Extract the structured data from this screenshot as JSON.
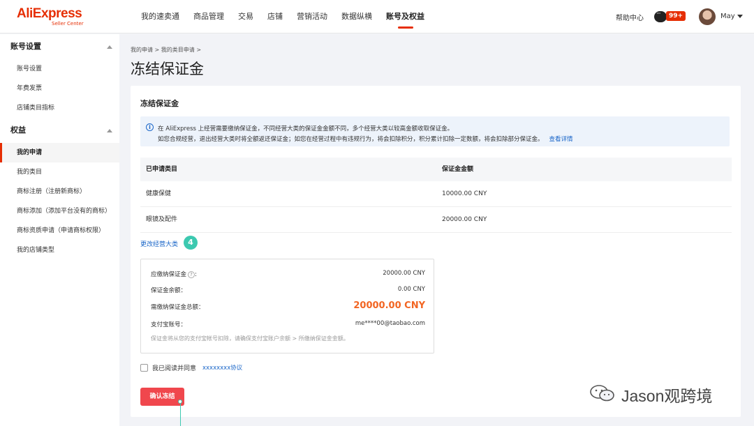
{
  "brand": {
    "name": "AliExpress",
    "sub": "Seller Center",
    "color": "#e62e04"
  },
  "nav": {
    "items": [
      {
        "label": "我的速卖通"
      },
      {
        "label": "商品管理"
      },
      {
        "label": "交易"
      },
      {
        "label": "店铺"
      },
      {
        "label": "营销活动"
      },
      {
        "label": "数据纵横"
      },
      {
        "label": "账号及权益",
        "active": true
      }
    ],
    "help": "帮助中心",
    "message_count": "99+",
    "user": "May"
  },
  "sidebar": {
    "groups": [
      {
        "title": "账号设置",
        "items": [
          "账号设置",
          "年费发票",
          "店铺类目指标"
        ]
      },
      {
        "title": "权益",
        "items": [
          "我的申请",
          "我的类目",
          "商标注册（注册新商标）",
          "商标添加（添加平台没有的商标）",
          "商标资质申请（申请商标权限）",
          "我的店铺类型"
        ]
      }
    ],
    "active": "我的申请"
  },
  "breadcrumb": "我的申请 > 我的类目申请 >",
  "page": {
    "title": "冻结保证金",
    "card_title": "冻结保证金",
    "notice": {
      "line1": "在 AliExpress 上经营需要缴纳保证金，不同经营大类的保证金金额不同，多个经营大类以较高金额收取保证金。",
      "line2": "如您合规经营，退出经营大类时将全额返还保证金；如您在经营过程中有违规行为，将会扣除积分，积分累计扣除一定数额，将会扣除部分保证金。",
      "link": "查看详情"
    },
    "table": {
      "headers": [
        "已申请类目",
        "保证金金额"
      ],
      "rows": [
        {
          "category": "健康保健",
          "amount": "10000.00  CNY"
        },
        {
          "category": "眼镜及配件",
          "amount": "20000.00  CNY"
        }
      ]
    },
    "change_link": "更改经营大类",
    "step_number": "4",
    "summary": {
      "due_label": "应缴纳保证金",
      "due_value": "20000.00  CNY",
      "balance_label": "保证金余额：",
      "balance_value": "0.00  CNY",
      "total_label": "需缴纳保证金总额：",
      "total_value": "20000.00  CNY",
      "alipay_label": "支付宝账号：",
      "alipay_value": "me****00@taobao.com",
      "note": "保证金将从您的支付宝帐号扣除，请确保支付宝账户余额 > 所缴纳保证金金额。"
    },
    "agree_text": "我已阅读并同意",
    "agree_link": "xxxxxxxx协议",
    "confirm_button": "确认冻结"
  },
  "watermark": "Jason观跨境",
  "colors": {
    "accent": "#e62e04",
    "link": "#1a66c8",
    "amount": "#f26522",
    "step": "#3cc9b0",
    "button": "#f0474d"
  }
}
